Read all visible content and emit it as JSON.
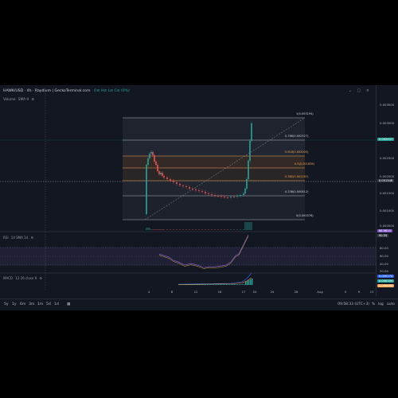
{
  "header": {
    "symbol_line": "HAWK/USD · 4h · Raydium | GeckoTerminal.com",
    "ohlc": "O⊘ H⊘ L⊘ C⊘ (0%)",
    "volume_label": "Volume",
    "volume_ma": "SMA 9"
  },
  "price_axis": {
    "ticks": [
      "0.003500",
      "0.003000",
      "0.002500",
      "0.002000",
      "0.001500",
      "0.001000",
      "0.000500"
    ],
    "current_badge": "0.002457",
    "crosshair_badge": "0.001348"
  },
  "fib": {
    "levels": [
      {
        "label": "1(0.003194)",
        "color": "#d1d4dc"
      },
      {
        "label": "0.786(0.002527)",
        "color": "#d1d4dc"
      },
      {
        "label": "0.618(0.002003)",
        "color": "#f7a64f"
      },
      {
        "label": "0.5(0.001636)",
        "color": "#f7a64f"
      },
      {
        "label": "0.382(0.001267)",
        "color": "#f7a64f"
      },
      {
        "label": "0.236(0.000812)",
        "color": "#d1d4dc"
      },
      {
        "label": "0(0.000076)",
        "color": "#d1d4dc"
      }
    ]
  },
  "rsi": {
    "label": "RSI",
    "params": "14 SMA 14",
    "badges": [
      "68.9814",
      "90.55"
    ],
    "ticks": [
      "80.00",
      "60.00",
      "40.00",
      "20.00"
    ]
  },
  "macd": {
    "label": "MACD",
    "params": "12 26 close 9",
    "badges": [
      "0.000174",
      "0.000104",
      "0.000060"
    ]
  },
  "time_axis": {
    "ticks": [
      "4",
      "8",
      "12",
      "16",
      "17",
      "20",
      "24",
      "28",
      "Aug",
      "5",
      "9",
      "13"
    ]
  },
  "bottom_bar": {
    "timeframes": [
      "5y",
      "1y",
      "6m",
      "3m",
      "1m",
      "5d",
      "1d"
    ],
    "time": "09:58:33 (UTC+3)",
    "percent": "%",
    "log": "log",
    "auto": "auto"
  },
  "colors": {
    "background": "#131722",
    "up": "#26a69a",
    "down": "#ef5350",
    "fib_orange": "#f7a64f",
    "rsi_line": "#7e57c2"
  }
}
